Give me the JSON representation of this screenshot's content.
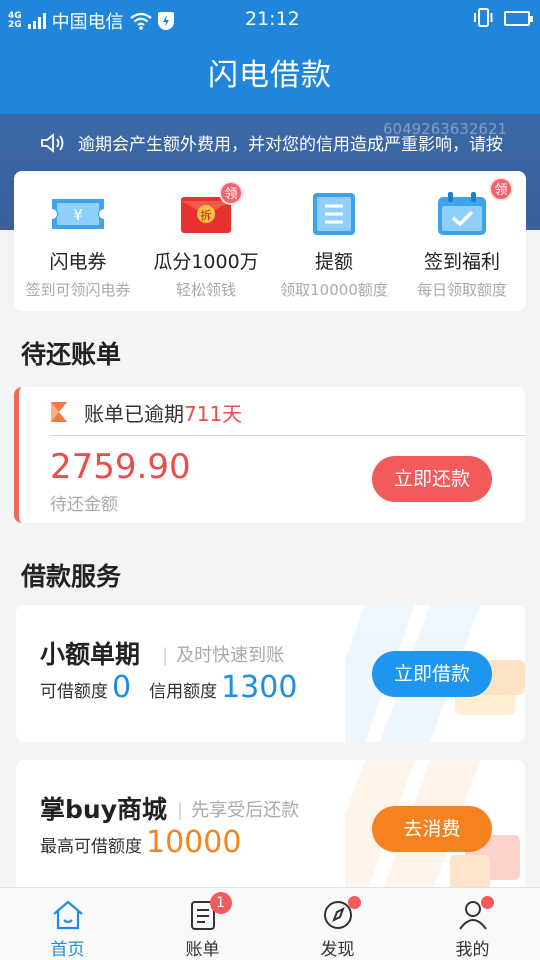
{
  "status_bar": {
    "net_top": "4G",
    "net_bottom": "2G",
    "carrier": "中国电信",
    "time": "21:12"
  },
  "header": {
    "title": "闪电借款"
  },
  "notice": {
    "watermark": "6049263632621",
    "text": "逾期会产生额外费用，并对您的信用造成严重影响，请按"
  },
  "features": [
    {
      "name": "闪电券",
      "sub": "签到可领闪电券",
      "icon": "ticket-icon",
      "badge": ""
    },
    {
      "name": "瓜分1000万",
      "sub": "轻松领钱",
      "icon": "red-envelope-icon",
      "badge": "领",
      "envelope_text": "拆"
    },
    {
      "name": "提额",
      "sub": "领取10000额度",
      "icon": "document-icon",
      "badge": ""
    },
    {
      "name": "签到福利",
      "sub": "每日领取额度",
      "icon": "calendar-check-icon",
      "badge": "领"
    }
  ],
  "bills": {
    "section_title": "待还账单",
    "overdue_prefix": "账单已逾期",
    "overdue_days": "711天",
    "amount": "2759.90",
    "amount_label": "待还金额",
    "pay_button": "立即还款"
  },
  "loans": {
    "section_title": "借款服务",
    "small": {
      "title": "小额单期",
      "subtitle": "及时快速到账",
      "available_label": "可借额度",
      "available_value": "0",
      "credit_label": "信用额度",
      "credit_value": "1300",
      "button": "立即借款"
    },
    "mall": {
      "title": "掌buy商城",
      "subtitle": "先享受后还款",
      "max_label": "最高可借额度",
      "max_value": "10000",
      "button": "去消费"
    }
  },
  "tabbar": [
    {
      "label": "首页",
      "icon": "home-icon",
      "active": true
    },
    {
      "label": "账单",
      "icon": "bill-list-icon",
      "badge": "1"
    },
    {
      "label": "发现",
      "icon": "compass-icon",
      "dot": true
    },
    {
      "label": "我的",
      "icon": "user-icon",
      "dot": true
    }
  ],
  "colors": {
    "primary": "#1f86dc",
    "danger": "#f25a5c",
    "orange": "#f4831f"
  }
}
